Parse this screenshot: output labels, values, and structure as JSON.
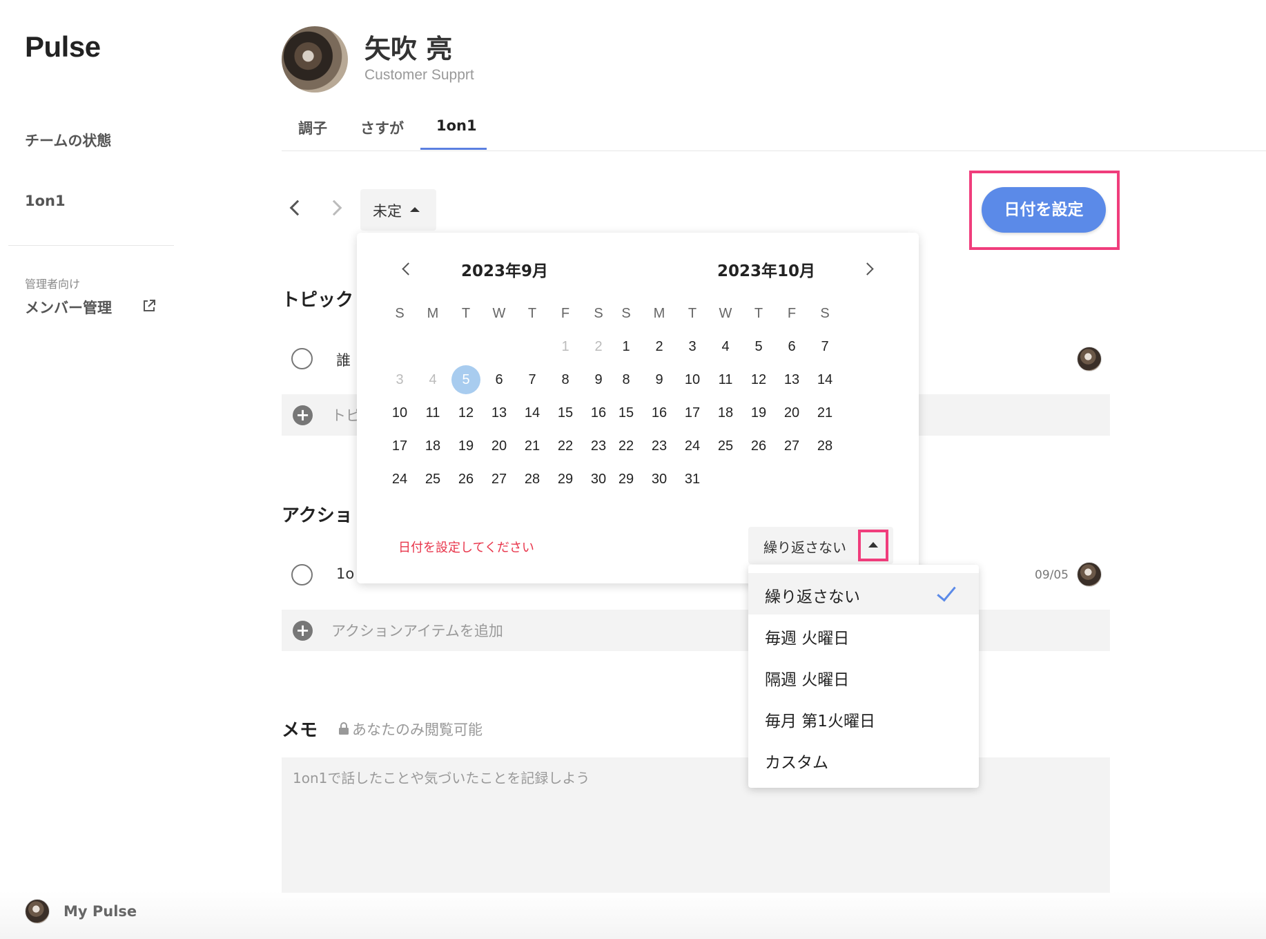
{
  "sidebar": {
    "logo": "Pulse",
    "nav": [
      "チームの状態",
      "1on1"
    ],
    "caption": "管理者向け",
    "admin_item": "メンバー管理",
    "footer_name": "My Pulse"
  },
  "header": {
    "name": "矢吹 亮",
    "role": "Customer Supprt",
    "tabs": [
      "調子",
      "さすが",
      "1on1"
    ],
    "active_tab": "1on1"
  },
  "toolbar": {
    "date_chip": "未定",
    "set_date_button": "日付を設定"
  },
  "topics": {
    "title": "トピック",
    "row_text": "誰",
    "add_placeholder": "トピ"
  },
  "actions": {
    "title": "アクショ",
    "row_text": "1o",
    "row_date": "09/05",
    "add_placeholder": "アクションアイテムを追加"
  },
  "memo": {
    "title": "メモ",
    "privacy_note": "あなたのみ閲覧可能",
    "placeholder": "1on1で話したことや気づいたことを記録しよう"
  },
  "calendar": {
    "weekdays": [
      "S",
      "M",
      "T",
      "W",
      "T",
      "F",
      "S"
    ],
    "months": [
      {
        "title": "2023年9月",
        "weeks": [
          [
            null,
            null,
            null,
            null,
            null,
            {
              "d": "1",
              "m": true
            },
            {
              "d": "2",
              "m": true
            }
          ],
          [
            {
              "d": "3",
              "m": true
            },
            {
              "d": "4",
              "m": true
            },
            {
              "d": "5",
              "s": true
            },
            {
              "d": "6"
            },
            {
              "d": "7"
            },
            {
              "d": "8"
            },
            {
              "d": "9"
            }
          ],
          [
            {
              "d": "10"
            },
            {
              "d": "11"
            },
            {
              "d": "12"
            },
            {
              "d": "13"
            },
            {
              "d": "14"
            },
            {
              "d": "15"
            },
            {
              "d": "16"
            }
          ],
          [
            {
              "d": "17"
            },
            {
              "d": "18"
            },
            {
              "d": "19"
            },
            {
              "d": "20"
            },
            {
              "d": "21"
            },
            {
              "d": "22"
            },
            {
              "d": "23"
            }
          ],
          [
            {
              "d": "24"
            },
            {
              "d": "25"
            },
            {
              "d": "26"
            },
            {
              "d": "27"
            },
            {
              "d": "28"
            },
            {
              "d": "29"
            },
            {
              "d": "30"
            }
          ]
        ]
      },
      {
        "title": "2023年10月",
        "weeks": [
          [
            {
              "d": "1"
            },
            {
              "d": "2"
            },
            {
              "d": "3"
            },
            {
              "d": "4"
            },
            {
              "d": "5"
            },
            {
              "d": "6"
            },
            {
              "d": "7"
            }
          ],
          [
            {
              "d": "8"
            },
            {
              "d": "9"
            },
            {
              "d": "10"
            },
            {
              "d": "11"
            },
            {
              "d": "12"
            },
            {
              "d": "13"
            },
            {
              "d": "14"
            }
          ],
          [
            {
              "d": "15"
            },
            {
              "d": "16"
            },
            {
              "d": "17"
            },
            {
              "d": "18"
            },
            {
              "d": "19"
            },
            {
              "d": "20"
            },
            {
              "d": "21"
            }
          ],
          [
            {
              "d": "22"
            },
            {
              "d": "23"
            },
            {
              "d": "24"
            },
            {
              "d": "25"
            },
            {
              "d": "26"
            },
            {
              "d": "27"
            },
            {
              "d": "28"
            }
          ],
          [
            {
              "d": "29"
            },
            {
              "d": "30"
            },
            {
              "d": "31"
            },
            null,
            null,
            null,
            null
          ]
        ]
      }
    ],
    "error": "日付を設定してください",
    "repeat_value": "繰り返さない"
  },
  "repeat_options": {
    "items": [
      "繰り返さない",
      "毎週 火曜日",
      "隔週 火曜日",
      "毎月 第1火曜日",
      "カスタム"
    ],
    "selected": "繰り返さない"
  },
  "colors": {
    "accent": "#5b8ae8",
    "highlight": "#f03d7c",
    "error": "#e8344a",
    "selected_day": "#a8ccef"
  }
}
